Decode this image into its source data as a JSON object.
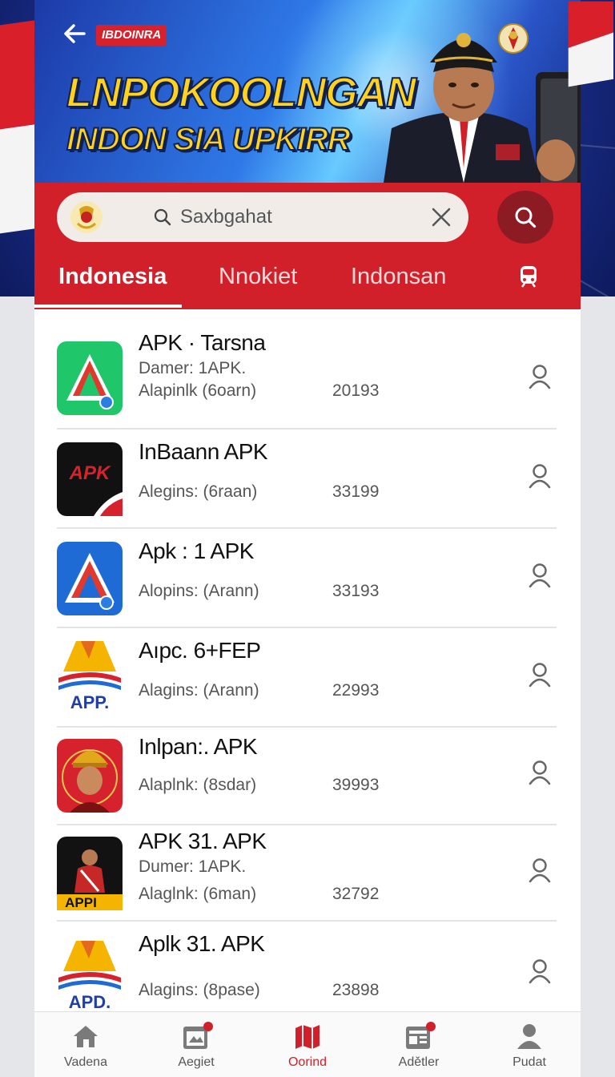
{
  "header": {
    "brand_badge": "IBDOINRA",
    "title_line1": "LNPOKOOLNGAN",
    "title_line2": "INDON SIA UPKIRR"
  },
  "search": {
    "value": "Saxbgahat"
  },
  "tabs": [
    {
      "label": "Indonesia",
      "active": true
    },
    {
      "label": "Nnokiet",
      "active": false
    },
    {
      "label": "Indonsan",
      "active": false
    }
  ],
  "apps": [
    {
      "name": "APK · Tarsna",
      "meta1": "Damer: 1APK.",
      "meta2": "Alapinlk (6oarn)",
      "count": "20193",
      "icon": "green-triangle-app-icon"
    },
    {
      "name": "InBaann APK",
      "meta1": "",
      "meta2": "Alegins: (6raan)",
      "count": "33199",
      "icon": "black-apk-app-icon"
    },
    {
      "name": "Apk : 1 APK",
      "meta1": "",
      "meta2": "Alopins: (Arann)",
      "count": "33193",
      "icon": "blue-triangle-app-icon"
    },
    {
      "name": "Aıpc. 6+FEP",
      "meta1": "",
      "meta2": "Alagins: (Arann)",
      "count": "22993",
      "icon": "yellow-app-logo-icon"
    },
    {
      "name": "Inlpan:. APK",
      "meta1": "",
      "meta2": "Alaplnk: (8sdar)",
      "count": "39993",
      "icon": "red-soldier-app-icon"
    },
    {
      "name": "APK 31. APK",
      "meta1": "Dumer: 1APK.",
      "meta2": "Alaglnk: (6man)",
      "count": "32792",
      "icon": "dark-player-app-icon"
    },
    {
      "name": "Aplk 31. APK",
      "meta1": "",
      "meta2": "Alagins: (8pase)",
      "count": "23898",
      "icon": "yellow-app-logo-icon"
    }
  ],
  "icon_labels": {
    "black_apk": "APK",
    "app_logo_4": "APP.",
    "dark_player": "APPI",
    "app_logo_7": "APD."
  },
  "bottom_nav": [
    {
      "label": "Vadena",
      "icon": "home-icon",
      "active": false
    },
    {
      "label": "Aegiet",
      "icon": "calendar-icon",
      "active": false
    },
    {
      "label": "Oorind",
      "icon": "map-icon",
      "active": true
    },
    {
      "label": "Adětler",
      "icon": "news-icon",
      "active": false
    },
    {
      "label": "Pudat",
      "icon": "profile-icon",
      "active": false
    }
  ],
  "colors": {
    "accent_red": "#d12029",
    "dark_red": "#8c1b24",
    "title_yellow": "#ffd21e"
  }
}
